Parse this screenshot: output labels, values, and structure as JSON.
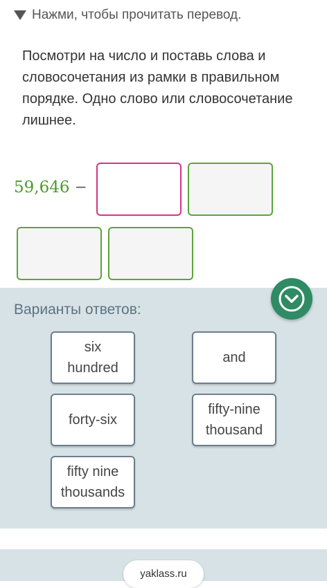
{
  "hint": {
    "text": "Нажми, чтобы прочитать перевод."
  },
  "task": {
    "instructions": "Посмотри на число и поставь слова и словосочетания из рамки в правильном порядке. Одно слово или словосочетание лишнее.",
    "number": "59,646",
    "dash": "–"
  },
  "answers": {
    "title": "Варианты ответов:",
    "options": [
      {
        "label": "six hundred"
      },
      {
        "label": "and"
      },
      {
        "label": "forty-six"
      },
      {
        "label": "fifty-nine thousand"
      },
      {
        "label": "fifty nine thousands"
      }
    ]
  },
  "footer": {
    "brand": "yaklass.ru"
  },
  "colors": {
    "accent_green": "#4c9a2a",
    "active_slot_border": "#d63384",
    "panel_background": "#d7e2e6",
    "collapse_button": "#2e8b64"
  }
}
